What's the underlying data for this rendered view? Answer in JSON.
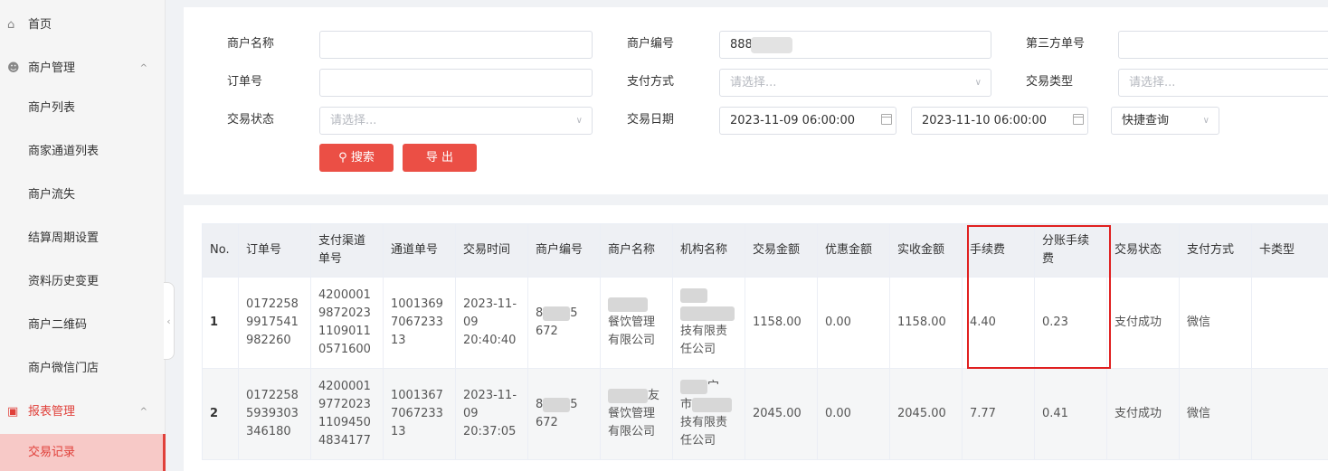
{
  "sidebar": {
    "items": [
      {
        "label": "首页",
        "icon": "home-icon"
      },
      {
        "label": "商户管理",
        "icon": "merchant-icon",
        "caret": "^"
      },
      {
        "label": "商户列表"
      },
      {
        "label": "商家通道列表"
      },
      {
        "label": "商户流失"
      },
      {
        "label": "结算周期设置"
      },
      {
        "label": "资料历史变更"
      },
      {
        "label": "商户二维码"
      },
      {
        "label": "商户微信门店"
      },
      {
        "label": "报表管理",
        "icon": "report-icon",
        "caret": "^"
      },
      {
        "label": "交易记录"
      }
    ],
    "collapse_glyph": "‹"
  },
  "filters": {
    "merchant_name_label": "商户名称",
    "merchant_name_value": "",
    "merchant_id_label": "商户编号",
    "merchant_id_value": "888",
    "third_party_no_label": "第三方单号",
    "third_party_no_value": "",
    "order_no_label": "订单号",
    "order_no_value": "",
    "pay_method_label": "支付方式",
    "pay_method_placeholder": "请选择...",
    "trade_type_label": "交易类型",
    "trade_type_placeholder": "请选择...",
    "trade_status_label": "交易状态",
    "trade_status_placeholder": "请选择...",
    "trade_date_label": "交易日期",
    "date_start": "2023-11-09 06:00:00",
    "date_end": "2023-11-10 06:00:00",
    "quick_query": "快捷查询",
    "search_button": "搜索",
    "export_button": "导 出"
  },
  "table": {
    "headers": {
      "no": "No.",
      "order_no": "订单号",
      "pay_channel_no": "支付渠道单号",
      "channel_no": "通道单号",
      "trade_time": "交易时间",
      "merchant_id": "商户编号",
      "merchant_name": "商户名称",
      "org_name": "机构名称",
      "trade_amount": "交易金额",
      "discount_amount": "优惠金额",
      "received_amount": "实收金额",
      "fee": "手续费",
      "split_fee": "分账手续费",
      "status": "交易状态",
      "pay_method": "支付方式",
      "card_type": "卡类型"
    },
    "rows": [
      {
        "no": "1",
        "order_no": "0172258 9917541 982260",
        "pay_channel_no": "4200001 9872023 1109011 0571600",
        "channel_no": "1001369 7067233 13",
        "trade_time": "2023-11- 09 20:40:40",
        "merchant_id_a": "8",
        "merchant_id_b": "5",
        "merchant_id_c": "672",
        "merchant_name": "餐饮管理 有限公司",
        "org_name": "技有限责 任公司",
        "trade_amount": "1158.00",
        "discount_amount": "0.00",
        "received_amount": "1158.00",
        "fee": "4.40",
        "split_fee": "0.23",
        "status": "支付成功",
        "pay_method": "微信",
        "card_type": ""
      },
      {
        "no": "2",
        "order_no": "0172258 5939303 346180",
        "pay_channel_no": "4200001 9772023 1109450 4834177",
        "channel_no": "1001367 7067233 13",
        "trade_time": "2023-11- 09 20:37:05",
        "merchant_id_a": "8",
        "merchant_id_b": "5",
        "merchant_id_c": "672",
        "merchant_name": "餐饮管理 有限公司",
        "org_name": "技有限责 任公司",
        "org_extra_a": "宀",
        "org_extra_b": "市",
        "name_extra": "友",
        "trade_amount": "2045.00",
        "discount_amount": "0.00",
        "received_amount": "2045.00",
        "fee": "7.77",
        "split_fee": "0.41",
        "status": "支付成功",
        "pay_method": "微信",
        "card_type": ""
      }
    ]
  },
  "colors": {
    "accent": "#eb4f45",
    "active_bg": "#f7c9c7",
    "highlight_border": "#e02020",
    "header_bg": "#eef0f4"
  }
}
